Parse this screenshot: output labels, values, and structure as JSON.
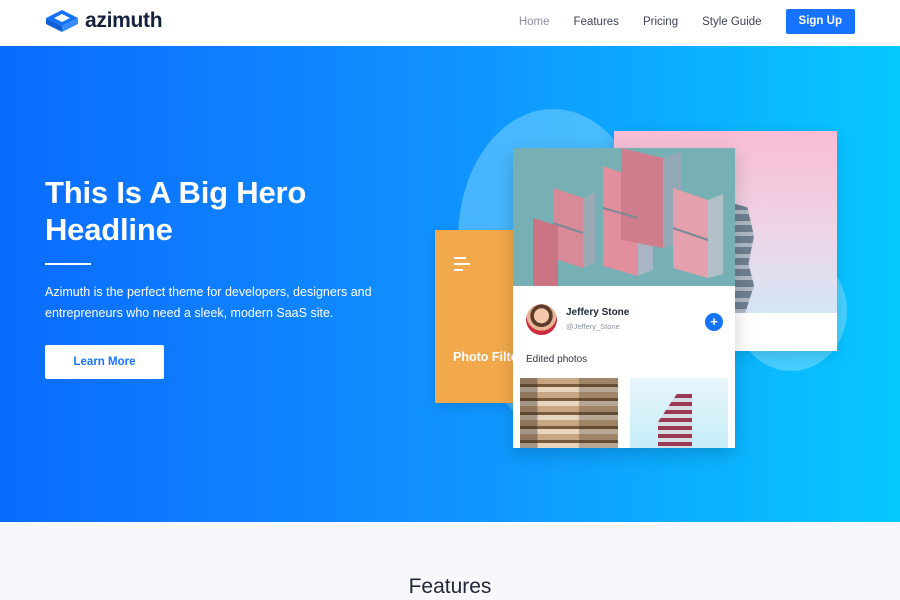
{
  "brand": {
    "name": "azimuth",
    "primary_color": "#1673ff"
  },
  "nav": {
    "links": [
      "Home",
      "Features",
      "Pricing",
      "Style Guide"
    ],
    "active": "Home",
    "signup_label": "Sign Up"
  },
  "hero": {
    "headline": "This Is A Big Hero Headline",
    "description": "Azimuth is the perfect theme for developers, designers and entrepreneurs who need a sleek, modern SaaS site.",
    "cta_label": "Learn More",
    "gradient": [
      "#0a6bff",
      "#07c8ff"
    ]
  },
  "mockup": {
    "orange_card": {
      "title": "Photo Filter Orange",
      "icon": "menu-icon"
    },
    "profile": {
      "name": "Jeffery Stone",
      "handle": "@Jeffery_Stone",
      "follow_icon": "+"
    },
    "edited_label": "Edited photos"
  },
  "features": {
    "title": "Features"
  }
}
